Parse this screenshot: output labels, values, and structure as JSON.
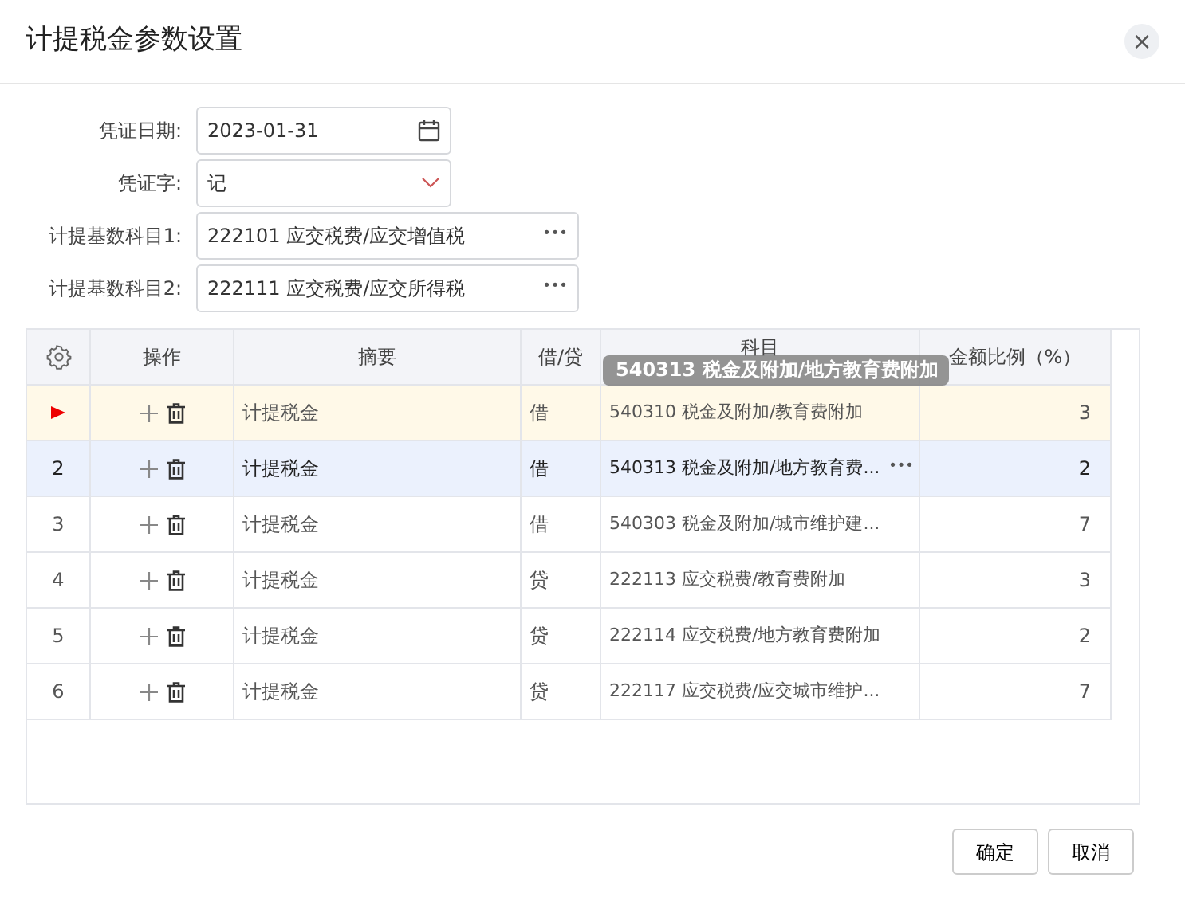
{
  "dialog": {
    "title": "计提税金参数设置",
    "close": "×"
  },
  "form": [
    {
      "kind": "date",
      "label": "凭证日期:",
      "value": "2023-01-31"
    },
    {
      "kind": "select",
      "label": "凭证字:",
      "value": "记"
    },
    {
      "kind": "lookup",
      "label": "计提基数科目1:",
      "value": "222101 应交税费/应交增值税",
      "button": "•••"
    },
    {
      "kind": "lookup",
      "label": "计提基数科目2:",
      "value": "222111 应交税费/应交所得税",
      "button": "•••"
    }
  ],
  "table": {
    "columns": [
      "操作",
      "摘要",
      "借/贷",
      "科目",
      "金额比例（%）"
    ],
    "rows": [
      {
        "current": true,
        "selected": false,
        "summary": "计提税金",
        "side": "借",
        "account": "540310 税金及附加/教育费附加",
        "ratio": "3"
      },
      {
        "number": "2",
        "current": false,
        "selected": true,
        "summary": "计提税金",
        "side": "借",
        "account": "540313 税金及附加/地方教育费...",
        "account_button": "•••",
        "ratio": "2"
      },
      {
        "number": "3",
        "current": false,
        "selected": false,
        "summary": "计提税金",
        "side": "借",
        "account": "540303 税金及附加/城市维护建...",
        "ratio": "7"
      },
      {
        "number": "4",
        "current": false,
        "selected": false,
        "summary": "计提税金",
        "side": "贷",
        "account": "222113 应交税费/教育费附加",
        "ratio": "3"
      },
      {
        "number": "5",
        "current": false,
        "selected": false,
        "summary": "计提税金",
        "side": "贷",
        "account": "222114 应交税费/地方教育费附加",
        "ratio": "2"
      },
      {
        "number": "6",
        "current": false,
        "selected": false,
        "summary": "计提税金",
        "side": "贷",
        "account": "222117 应交税费/应交城市维护...",
        "ratio": "7"
      }
    ],
    "tooltip": "540313 税金及附加/地方教育费附加"
  },
  "buttons": [
    "确定",
    "取消"
  ]
}
